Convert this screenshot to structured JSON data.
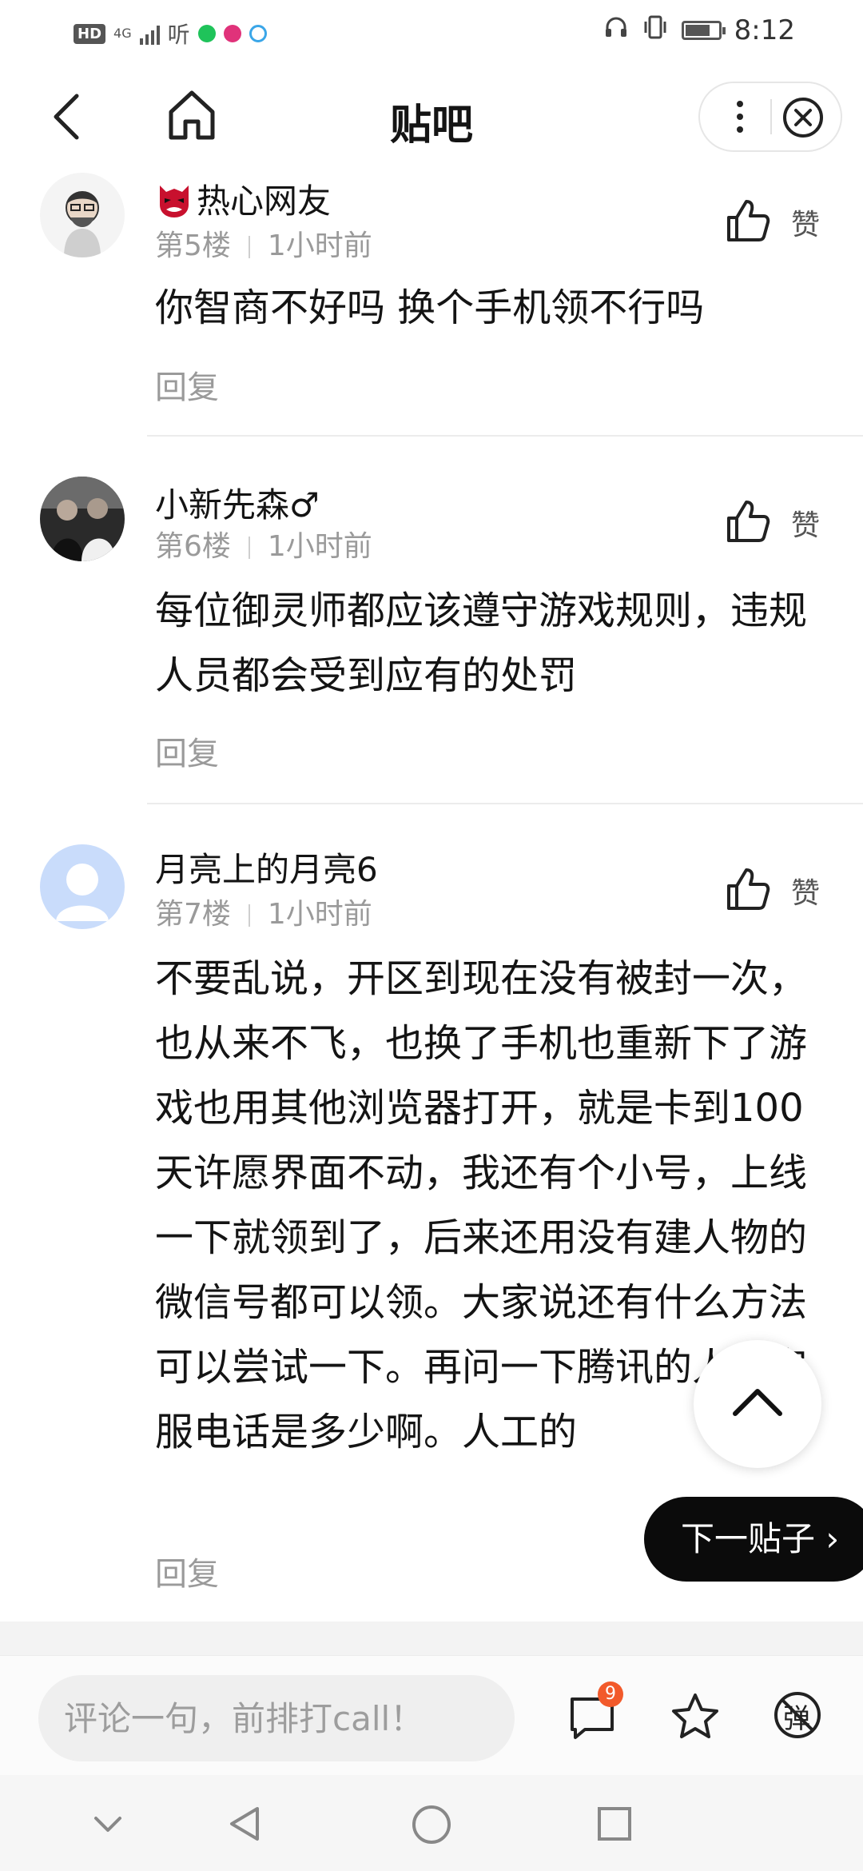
{
  "status_bar": {
    "network_label": "HD",
    "network_type": "4G",
    "app_label": "听",
    "time": "8:12",
    "icons": [
      "headphones-icon",
      "vibrate-icon",
      "battery-icon"
    ]
  },
  "nav": {
    "title": "贴吧",
    "back_icon": "chevron-left-icon",
    "home_icon": "home-icon",
    "more_icon": "more-vertical-icon",
    "close_icon": "close-circle-icon"
  },
  "posts": [
    {
      "username": "热心网友",
      "floor": "第5楼",
      "time": "1小时前",
      "like_label": "赞",
      "content": "你智商不好吗 换个手机领不行吗",
      "reply_label": "回复"
    },
    {
      "username": "小新先森♂",
      "floor": "第6楼",
      "time": "1小时前",
      "like_label": "赞",
      "content": "每位御灵师都应该遵守游戏规则，违规人员都会受到应有的处罚",
      "reply_label": "回复"
    },
    {
      "username": "月亮上的月亮6",
      "floor": "第7楼",
      "time": "1小时前",
      "like_label": "赞",
      "content": "不要乱说，开区到现在没有被封一次，也从来不飞，也换了手机也重新下了游戏也用其他浏览器打开，就是卡到100天许愿界面不动，我还有个小号，上线一下就领到了，后来还用没有建人物的微信号都可以领。大家说还有什么方法可以尝试一下。再问一下腾讯的人工客服电话是多少啊。人工的",
      "reply_label": "回复"
    }
  ],
  "floating": {
    "next_post_label": "下一贴子 ›",
    "scroll_top_icon": "chevron-up-icon"
  },
  "bottom_bar": {
    "comment_placeholder": "评论一句，前排打call！",
    "comment_count": "9",
    "danmaku_label": "弹"
  },
  "colors": {
    "text_primary": "#141414",
    "text_secondary": "#9a9a9a",
    "badge": "#f25a2b",
    "next_button": "#0b0b0b"
  }
}
